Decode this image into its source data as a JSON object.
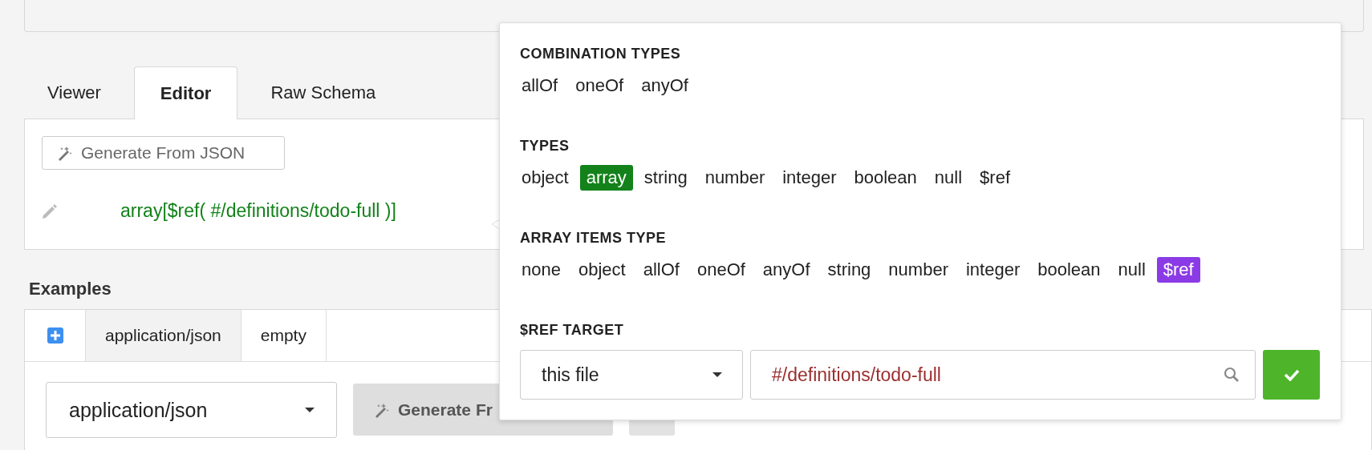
{
  "tabs": [
    {
      "label": "Viewer",
      "selected": false
    },
    {
      "label": "Editor",
      "selected": true
    },
    {
      "label": "Raw Schema",
      "selected": false
    }
  ],
  "editor": {
    "generate_button": "Generate From JSON",
    "type_expression": "array[$ref( #/definitions/todo-full )]"
  },
  "examples": {
    "title": "Examples",
    "tabs": [
      {
        "label": "application/json",
        "selected": true
      },
      {
        "label": "empty",
        "selected": false
      }
    ],
    "media_type_select": "application/json",
    "generate_button": "Generate Fr"
  },
  "type_popover": {
    "sections": [
      {
        "kind": "combination",
        "heading": "COMBINATION TYPES",
        "options": [
          {
            "label": "allOf",
            "selected": false
          },
          {
            "label": "oneOf",
            "selected": false
          },
          {
            "label": "anyOf",
            "selected": false
          }
        ]
      },
      {
        "kind": "types",
        "heading": "TYPES",
        "options": [
          {
            "label": "object",
            "selected": false
          },
          {
            "label": "array",
            "selected": true
          },
          {
            "label": "string",
            "selected": false
          },
          {
            "label": "number",
            "selected": false
          },
          {
            "label": "integer",
            "selected": false
          },
          {
            "label": "boolean",
            "selected": false
          },
          {
            "label": "null",
            "selected": false
          },
          {
            "label": "$ref",
            "selected": false
          }
        ]
      },
      {
        "kind": "items",
        "heading": "ARRAY ITEMS TYPE",
        "options": [
          {
            "label": "none",
            "selected": false
          },
          {
            "label": "object",
            "selected": false
          },
          {
            "label": "allOf",
            "selected": false
          },
          {
            "label": "oneOf",
            "selected": false
          },
          {
            "label": "anyOf",
            "selected": false
          },
          {
            "label": "string",
            "selected": false
          },
          {
            "label": "number",
            "selected": false
          },
          {
            "label": "integer",
            "selected": false
          },
          {
            "label": "boolean",
            "selected": false
          },
          {
            "label": "null",
            "selected": false
          },
          {
            "label": "$ref",
            "selected": true
          }
        ]
      },
      {
        "kind": "ref_target",
        "heading": "$REF TARGET",
        "source_select": "this file",
        "ref_value": "#/definitions/todo-full"
      }
    ]
  }
}
